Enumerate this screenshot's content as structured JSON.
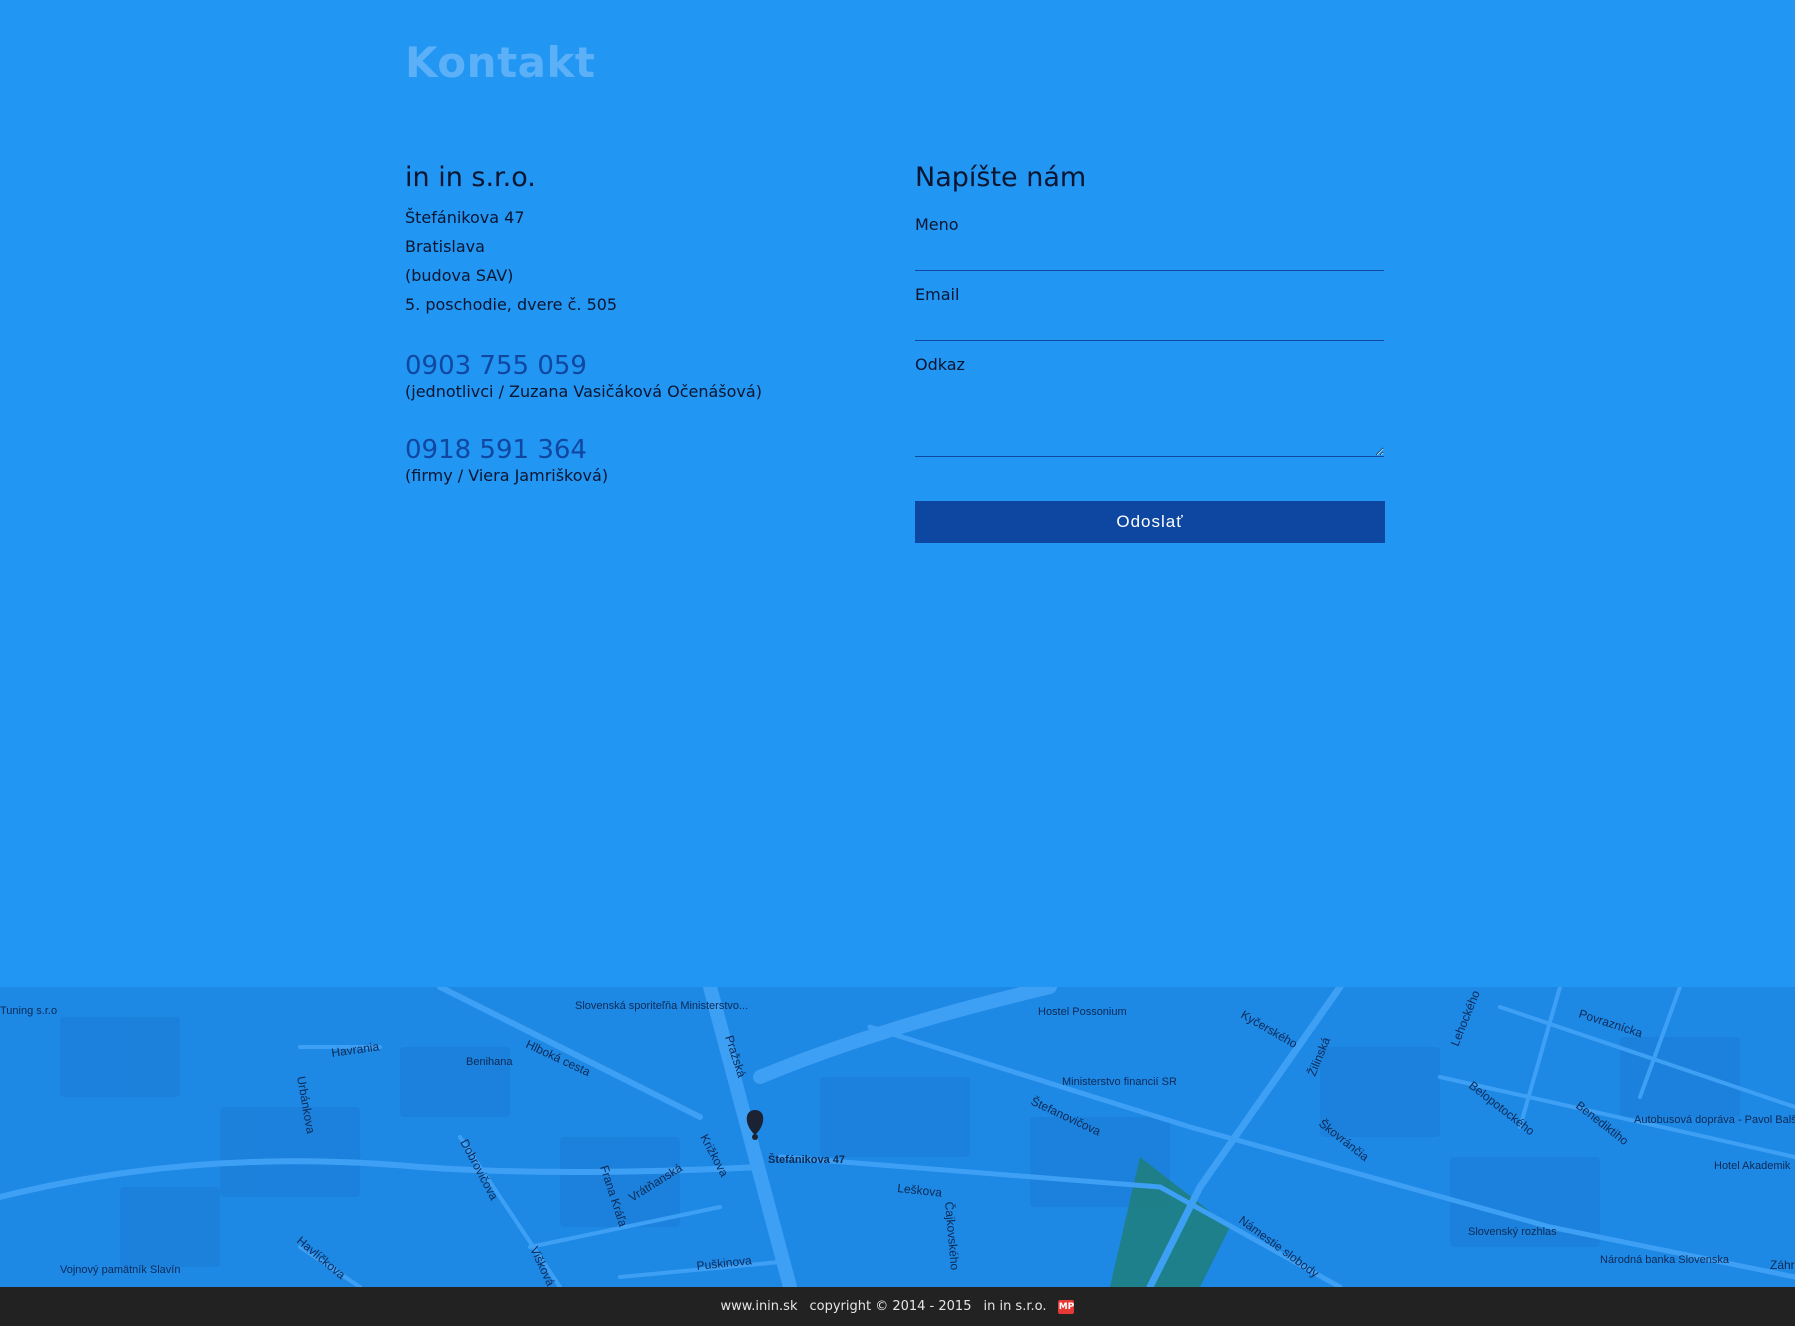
{
  "page": {
    "title": "Kontakt"
  },
  "company": {
    "name": "in in s.r.o.",
    "address": [
      "Štefánikova 47",
      "Bratislava",
      "(budova SAV)",
      "5. poschodie, dvere č. 505"
    ],
    "phones": [
      {
        "number": "0903 755 059",
        "note": "(jednotlivci / Zuzana Vasičáková Očenášová)"
      },
      {
        "number": "0918 591 364",
        "note": "(firmy / Viera Jamrišková)"
      }
    ]
  },
  "form": {
    "title": "Napíšte nám",
    "name_label": "Meno",
    "email_label": "Email",
    "message_label": "Odkaz",
    "submit_label": "Odoslať"
  },
  "map": {
    "marker_label": "Štefánikova 47",
    "places": [
      "Slovenská sporiteľňa Ministerstvo...",
      "Hostel Possonium",
      "Benihana",
      "Ministerstvo financií SR",
      "Autobusová dopráva - Pavol Balšan",
      "Hotel Akademik",
      "Slovenský rozhlas",
      "Národná banka Slovenska",
      "Vojnový pamätník Slavín",
      "Tuning s.r.o"
    ],
    "streets": [
      "Havrania",
      "Hlboká cesta",
      "Pražská",
      "Kyčerského",
      "Žilinská",
      "Lehockého",
      "Povraznícka",
      "Urbánkova",
      "Štefanovičova",
      "Belopotockého",
      "Benediktiho",
      "Škovránčia",
      "Dobrovičova",
      "Frana Kráľa",
      "Vrátňanská",
      "Križkova",
      "Leškova",
      "Čajkovského",
      "Námestie slobody",
      "Havlíčkova",
      "Puškinova",
      "Višková",
      "Záhr"
    ]
  },
  "footer": {
    "site": "www.inin.sk",
    "copyright": "copyright © 2014 - 2015",
    "company": "in in s.r.o.",
    "logo": "MP"
  },
  "colors": {
    "background": "#2196f3",
    "accent": "#0e47a1",
    "footer": "#222222"
  }
}
